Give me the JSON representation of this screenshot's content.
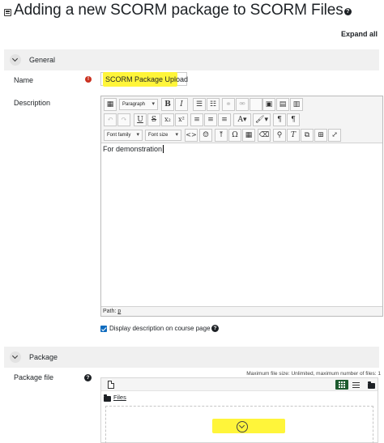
{
  "page": {
    "title": "Adding a new SCORM package to SCORM Files",
    "expand_all": "Expand all"
  },
  "sections": {
    "general": "General",
    "package": "Package"
  },
  "form": {
    "name_label": "Name",
    "name_value": "SCORM Package Upload",
    "description_label": "Description",
    "description_text": "For demonstration",
    "path_label": "Path:",
    "path_value": "p",
    "display_description_label": "Display description on course page",
    "display_description_checked": true,
    "package_file_label": "Package file",
    "max_file_text": "Maximum file size: Unlimited, maximum number of files: 1",
    "files_folder": "Files"
  },
  "editor": {
    "format_select": "Paragraph",
    "font_family_select": "Font family",
    "font_size_select": "Font size",
    "row1": [
      "bold",
      "italic",
      "bullet-list",
      "numbered-list",
      "link",
      "unlink",
      "image",
      "media",
      "paste"
    ],
    "row2": [
      "undo",
      "redo",
      "underline",
      "strikethrough",
      "subscript",
      "superscript",
      "align-left",
      "align-center",
      "align-right",
      "text-color",
      "background-color",
      "ltr",
      "rtl"
    ],
    "row3": [
      "html",
      "emoticon",
      "special-char",
      "table",
      "clear-format",
      "anchor",
      "find-replace",
      "spellcheck",
      "fullscreen"
    ]
  },
  "colors": {
    "highlight": "#fff53a",
    "checkbox": "#0f6cbf",
    "required": "#ca3120",
    "active_view": "#1e5c30"
  }
}
